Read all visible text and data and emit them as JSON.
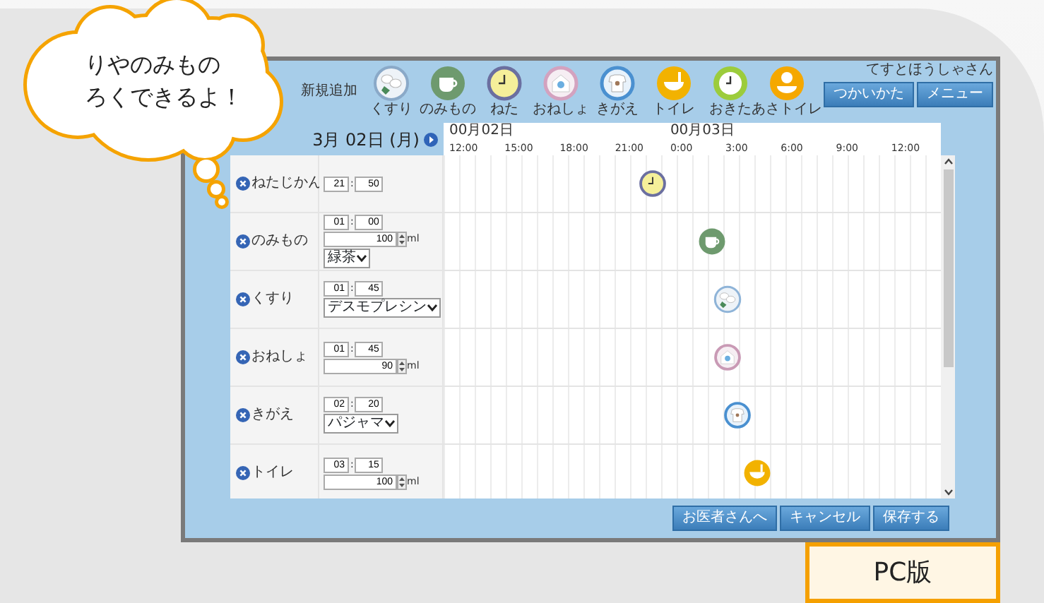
{
  "bubble": {
    "lines": [
      "りやのみもの",
      "ろくできるよ！"
    ]
  },
  "header": {
    "add_label": "新規追加",
    "add_icons": [
      {
        "kind": "medicine",
        "label": "くすり",
        "color": "#8aa9c8"
      },
      {
        "kind": "drink",
        "label": "のみもの",
        "color": "#6e9a6e"
      },
      {
        "kind": "sleep",
        "label": "ねた",
        "color": "#6b6fa0"
      },
      {
        "kind": "bedwetting",
        "label": "おねしょ",
        "color": "#d3a2bf"
      },
      {
        "kind": "change",
        "label": "きがえ",
        "color": "#4a90d0"
      },
      {
        "kind": "toilet",
        "label": "トイレ",
        "color": "#f2b200"
      },
      {
        "kind": "wake",
        "label": "おきた",
        "color": "#9ccc3c"
      },
      {
        "kind": "morning-toilet",
        "label": "あさトイレ",
        "color": "#f5a800"
      }
    ],
    "user": "てすとほうしゃさん",
    "buttons": [
      "つかいかた",
      "メニュー"
    ]
  },
  "date": "3月 02日 (月)",
  "timeline": {
    "dates": [
      "00月02日",
      "00月03日"
    ],
    "times": [
      "12:00",
      "15:00",
      "18:00",
      "21:00",
      "0:00",
      "3:00",
      "6:00",
      "9:00",
      "12:00"
    ]
  },
  "rows": [
    {
      "kind": "sleep",
      "name": "ねたじかん",
      "hour": "21",
      "sep": ":",
      "minute": "50",
      "color": "#6b6fa0",
      "level": 0.42
    },
    {
      "kind": "drink",
      "name": "のみもの",
      "hour": "01",
      "sep": ":",
      "minute": "00",
      "amount": {
        "value": "100",
        "unit": "ml"
      },
      "choice": "緑茶",
      "color": "#6e9a6e",
      "level": 0.54
    },
    {
      "kind": "medicine",
      "name": "くすり",
      "hour": "01",
      "sep": ":",
      "minute": "45",
      "choice": "デスモプレシン",
      "color": "#8fb4d8",
      "level": 0.57
    },
    {
      "kind": "bedwetting",
      "name": "おねしょ",
      "hour": "01",
      "sep": ":",
      "minute": "45",
      "amount": {
        "value": "90",
        "unit": "ml"
      },
      "color": "#c99ab5",
      "level": 0.57
    },
    {
      "kind": "change",
      "name": "きがえ",
      "hour": "02",
      "sep": ":",
      "minute": "20",
      "choice": "パジャマ",
      "color": "#4a90d0",
      "level": 0.59
    },
    {
      "kind": "toilet",
      "name": "トイレ",
      "hour": "03",
      "sep": ":",
      "minute": "15",
      "amount": {
        "value": "100",
        "unit": "ml"
      },
      "color": "#f2b200",
      "level": 0.63
    }
  ],
  "footer_buttons": [
    "お医者さんへ",
    "キャンセル",
    "保存する"
  ],
  "badge": "PC版"
}
